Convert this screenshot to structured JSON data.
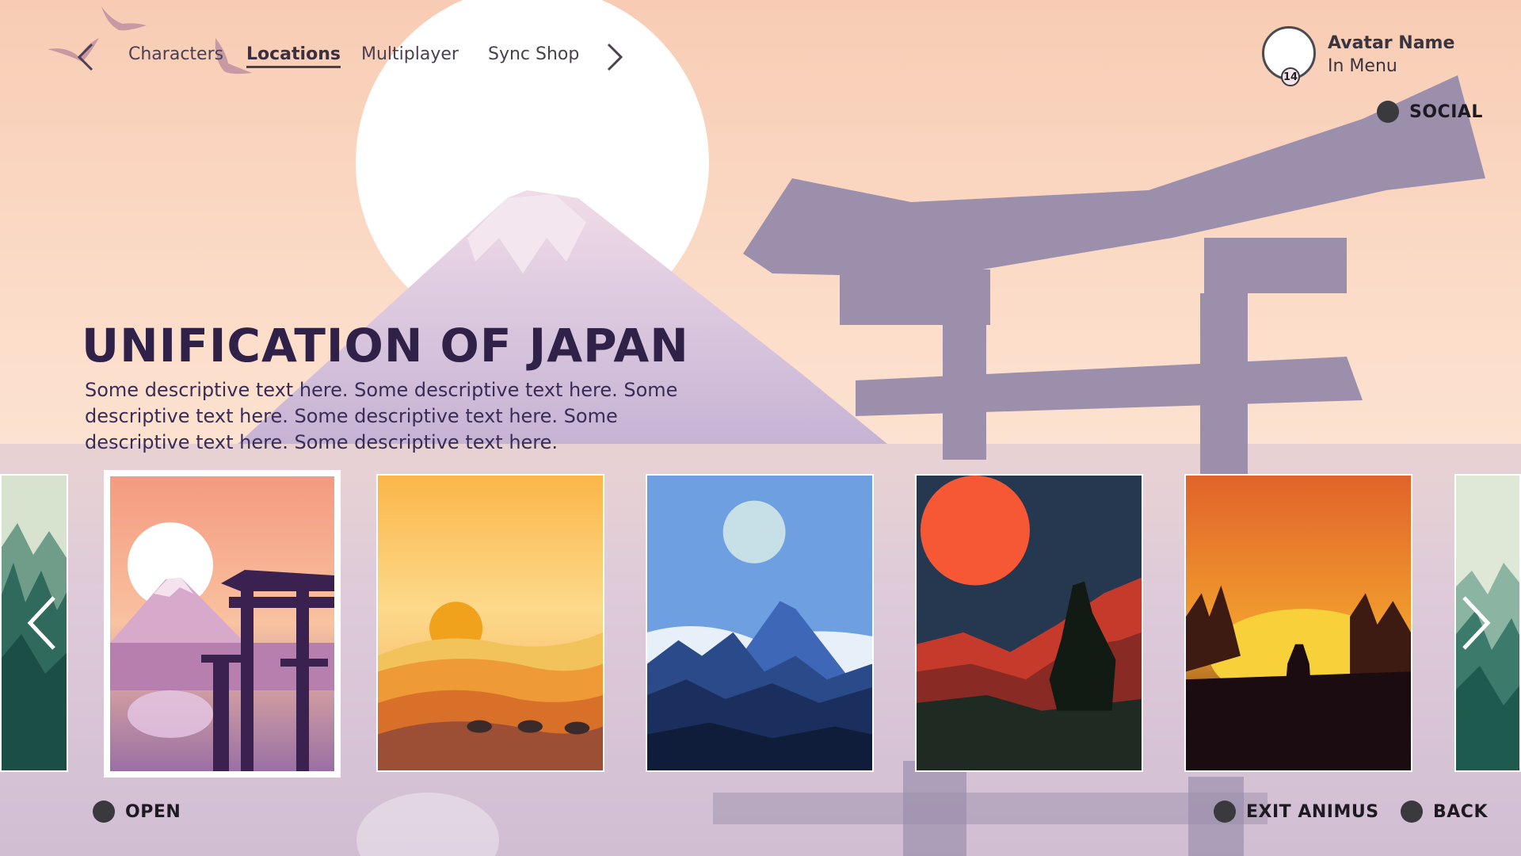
{
  "nav": {
    "tabs": [
      {
        "label": "Characters"
      },
      {
        "label": "Locations"
      },
      {
        "label": "Multiplayer"
      },
      {
        "label": "Sync Shop"
      }
    ],
    "active_tab": "Locations",
    "prev_icon": "chevron-left-icon",
    "next_icon": "chevron-right-icon"
  },
  "profile": {
    "name": "Avatar Name",
    "status": "In Menu",
    "level": "14",
    "social_label": "SOCIAL"
  },
  "location": {
    "title": "UNIFICATION OF JAPAN",
    "description": "Some descriptive text here. Some descriptive text here. Some descriptive text here. Some descriptive text here. Some descriptive text here. Some descriptive text here."
  },
  "carousel": {
    "selected_index": 0,
    "cards": [
      {
        "scene": "japan-torii-fuji"
      },
      {
        "scene": "desert-camels"
      },
      {
        "scene": "blue-mountain-moon"
      },
      {
        "scene": "red-sun-warrior"
      },
      {
        "scene": "forest-sunset-hunter"
      }
    ]
  },
  "footer": {
    "open_label": "OPEN",
    "exit_label": "EXIT ANIMUS",
    "back_label": "BACK"
  },
  "colors": {
    "title": "#2f2148",
    "torii": "#9b8fac",
    "button_dot": "#3a3a3e"
  }
}
